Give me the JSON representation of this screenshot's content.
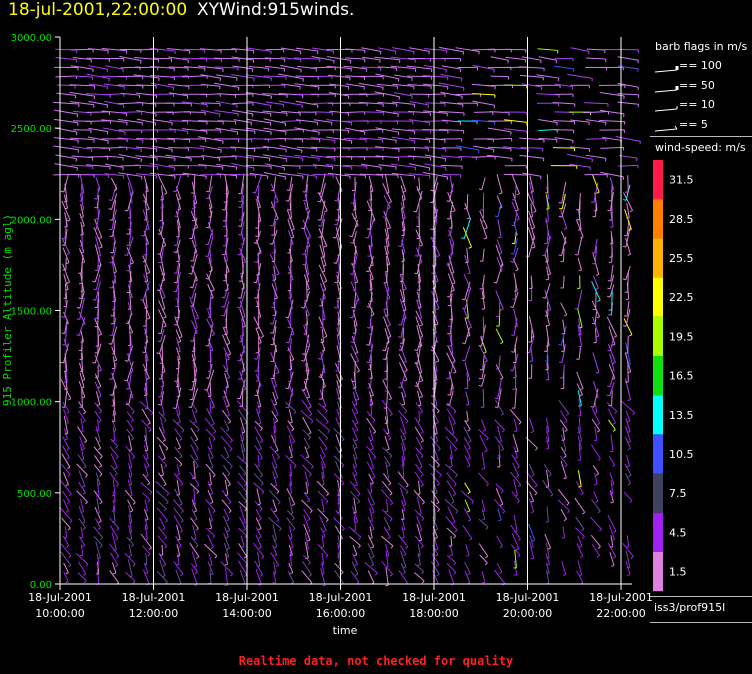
{
  "header": {
    "datetime": "18-jul-2001,22:00:00",
    "product": "XYWind:915winds."
  },
  "footer": {
    "warning": "Realtime data, not checked for quality"
  },
  "legend": {
    "barb_title": "barb flags in m/s",
    "barbs": [
      "== 100",
      "== 50",
      "== 10",
      "== 5"
    ],
    "speed_title": "wind-speed: m/s",
    "speed_labels": [
      "31.5",
      "28.5",
      "25.5",
      "22.5",
      "19.5",
      "16.5",
      "13.5",
      "10.5",
      "7.5",
      "4.5",
      "1.5"
    ],
    "speed_colors": [
      "#ff1a4a",
      "#ff8000",
      "#ffb300",
      "#ffff00",
      "#a8ff00",
      "#10e010",
      "#00ffff",
      "#4050ff",
      "#404060",
      "#a020f0",
      "#e080e0"
    ],
    "station": "iss3/prof915l"
  },
  "chart_data": {
    "type": "wind-barb time-height",
    "ylabel": "915 Profiler Altitude (m agl)",
    "xlabel": "time",
    "ylim": [
      0,
      3000
    ],
    "y_ticks": [
      "0.00",
      "500.00",
      "1000.00",
      "1500.00",
      "2000.00",
      "2500.00",
      "3000.00"
    ],
    "x_ticks": [
      {
        "date": "18-Jul-2001",
        "time": "10:00:00"
      },
      {
        "date": "18-Jul-2001",
        "time": "12:00:00"
      },
      {
        "date": "18-Jul-2001",
        "time": "14:00:00"
      },
      {
        "date": "18-Jul-2001",
        "time": "16:00:00"
      },
      {
        "date": "18-Jul-2001",
        "time": "18:00:00"
      },
      {
        "date": "18-Jul-2001",
        "time": "20:00:00"
      },
      {
        "date": "18-Jul-2001",
        "time": "22:00:00"
      }
    ],
    "grid_color": "#ffffff",
    "axis_label_color": "#00e000"
  }
}
